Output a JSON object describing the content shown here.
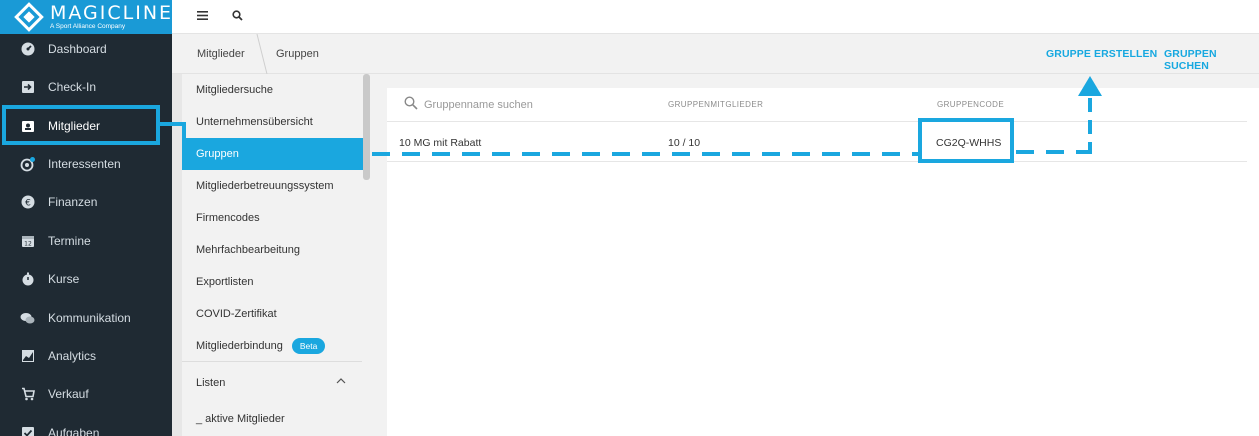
{
  "brand": {
    "title": "MAGICLINE",
    "subtitle": "A Sport Alliance Company"
  },
  "nav": [
    {
      "label": "Dashboard",
      "icon": "dashboard-icon"
    },
    {
      "label": "Check-In",
      "icon": "check-in-icon"
    },
    {
      "label": "Mitglieder",
      "icon": "members-icon"
    },
    {
      "label": "Interessenten",
      "icon": "prospects-icon"
    },
    {
      "label": "Finanzen",
      "icon": "euro-icon"
    },
    {
      "label": "Termine",
      "icon": "calendar-icon"
    },
    {
      "label": "Kurse",
      "icon": "stopwatch-icon"
    },
    {
      "label": "Kommunikation",
      "icon": "chat-icon"
    },
    {
      "label": "Analytics",
      "icon": "chart-icon"
    },
    {
      "label": "Verkauf",
      "icon": "cart-icon"
    },
    {
      "label": "Aufgaben",
      "icon": "checkbox-icon"
    }
  ],
  "topbar": {
    "menu_icon": "hamburger-icon",
    "search_icon": "search-icon"
  },
  "breadcrumb": {
    "first": "Mitglieder",
    "second": "Gruppen"
  },
  "actions": {
    "create": "GRUPPE ERSTELLEN",
    "search": "GRUPPEN SUCHEN"
  },
  "submenu": {
    "items": [
      "Mitgliedersuche",
      "Unternehmensübersicht",
      "Gruppen",
      "Mitgliederbetreuungssystem",
      "Firmencodes",
      "Mehrfachbearbeitung",
      "Exportlisten",
      "COVID-Zertifikat",
      "Mitgliederbindung"
    ],
    "beta_badge": "Beta",
    "lists_header": "Listen",
    "list_items": [
      "_ aktive Mitglieder"
    ]
  },
  "table": {
    "search_placeholder": "Gruppenname suchen",
    "columns": [
      "GRUPPENMITGLIEDER",
      "GRUPPENCODE"
    ],
    "rows": [
      {
        "name": "10 MG mit Rabatt",
        "members": "10 / 10",
        "code": "CG2Q-WHHS"
      }
    ]
  },
  "colors": {
    "accent": "#1aa7df",
    "sidebar": "#1f2a33",
    "logo_bg": "#1a9ad6"
  }
}
